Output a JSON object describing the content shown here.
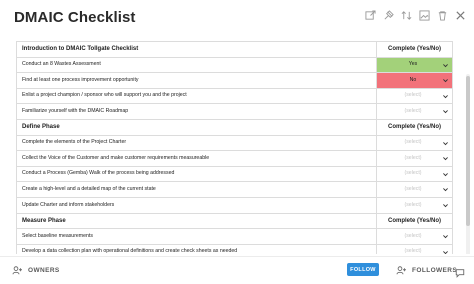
{
  "window": {
    "title": "DMAIC Checklist"
  },
  "toolbar_icons": [
    "external-link-icon",
    "pin-icon",
    "sort-icon",
    "image-icon",
    "trash-icon",
    "close-icon"
  ],
  "table": {
    "rows": [
      {
        "type": "section",
        "label": "Introduction to DMAIC Tollgate Checklist",
        "col2": "Complete (Yes/No)"
      },
      {
        "type": "item",
        "label": "Conduct an 8 Wastes Assessment",
        "value": "Yes",
        "status": "yes"
      },
      {
        "type": "item",
        "label": "Find at least one process improvement opportunity",
        "value": "No",
        "status": "no"
      },
      {
        "type": "item",
        "label": "Enlist a project champion / sponsor who will support you and the project",
        "value": "(select)",
        "status": "empty"
      },
      {
        "type": "item",
        "label": "Familiarize yourself with the DMAIC Roadmap",
        "value": "(select)",
        "status": "empty"
      },
      {
        "type": "section",
        "label": "Define Phase",
        "col2": "Complete (Yes/No)"
      },
      {
        "type": "item",
        "label": "Complete the elements of the Project Charter",
        "value": "(select)",
        "status": "empty"
      },
      {
        "type": "item",
        "label": "Collect the Voice of the Customer and make customer requirements measureable",
        "value": "(select)",
        "status": "empty"
      },
      {
        "type": "item",
        "label": "Conduct a Process (Gemba) Walk of the process being addressed",
        "value": "(select)",
        "status": "empty"
      },
      {
        "type": "item",
        "label": "Create a high-level and a detailed map of the current state",
        "value": "(select)",
        "status": "empty"
      },
      {
        "type": "item",
        "label": "Update Charter and inform stakeholders",
        "value": "(select)",
        "status": "empty"
      },
      {
        "type": "section",
        "label": "Measure Phase",
        "col2": "Complete (Yes/No)"
      },
      {
        "type": "item",
        "label": "Select baseline measurements",
        "value": "(select)",
        "status": "empty"
      },
      {
        "type": "item",
        "label": "Develop a data collection plan with operational definitions and create check sheets as needed",
        "value": "(select)",
        "status": "empty"
      }
    ]
  },
  "footer": {
    "owners_label": "OWNERS",
    "follow_label": "FOLLOW",
    "followers_label": "FOLLOWERS"
  },
  "colors": {
    "yes": "#a3d17a",
    "no": "#f2727a",
    "follow": "#2f8fdc"
  }
}
